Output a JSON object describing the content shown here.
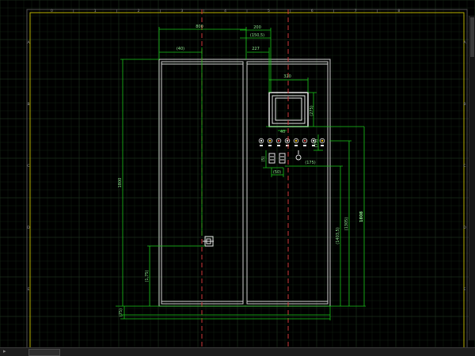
{
  "drawing": {
    "ruler_columns": [
      "0",
      "1",
      "2",
      "3",
      "4",
      "5",
      "6",
      "7",
      "8"
    ],
    "ruler_rows": [
      "A",
      "B",
      "C",
      "D",
      "E",
      "F"
    ],
    "dimensions": {
      "overall_width": "800",
      "left_door_width": "(40)",
      "right_offset": "200",
      "panel_half_width": "(150,5)",
      "panel_offset": "227",
      "screen_width": "320",
      "screen_height": "(275)",
      "button_spacing": "40",
      "button_rows": "(75)",
      "overall_height": "1800",
      "lower_height": "(1305)",
      "mid_height": "(1403,5)",
      "right_total": "1808",
      "handle_height": "(1,75)",
      "base": "(75)",
      "small_a": "(5)",
      "small_b": "(50)",
      "small_c": "(175)"
    }
  },
  "colors": {
    "background": "#000000",
    "grid": "#1b2e1b",
    "dimension": "#18c418",
    "dimension_text": "#8fe68f",
    "frame": "#cfcfcf",
    "centerline": "#d23a3a",
    "border": "#b9b000",
    "ruler_text": "#9a9a9a"
  }
}
